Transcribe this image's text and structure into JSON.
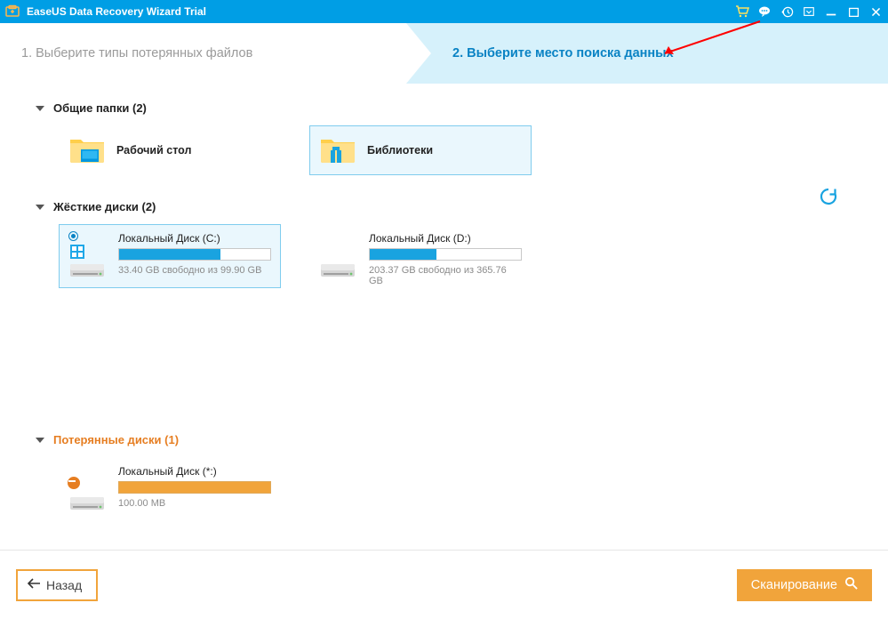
{
  "titlebar": {
    "app_name": "EaseUS Data Recovery Wizard Trial"
  },
  "steps": {
    "step1": "1. Выберите типы потерянных файлов",
    "step2": "2. Выберите место поиска данных"
  },
  "sections": {
    "common": {
      "title": "Общие папки (2)"
    },
    "hard": {
      "title": "Жёсткие диски (2)"
    },
    "lost": {
      "title": "Потерянные диски (1)"
    }
  },
  "common_folders": {
    "desktop": {
      "label": "Рабочий стол"
    },
    "libraries": {
      "label": "Библиотеки"
    }
  },
  "disks": {
    "c": {
      "name": "Локальный Диск (C:)",
      "free_text": "33.40 GB свободно из 99.90 GB",
      "fill_pct": 67
    },
    "d": {
      "name": "Локальный Диск (D:)",
      "free_text": "203.37 GB свободно из 365.76 GB",
      "fill_pct": 44
    }
  },
  "lost_disks": {
    "star": {
      "name": "Локальный Диск (*:)",
      "free_text": "100.00 MB",
      "fill_pct": 100
    }
  },
  "footer": {
    "back": "Назад",
    "scan": "Сканирование"
  },
  "colors": {
    "primary": "#009ee5",
    "accent": "#f1a43b",
    "step_active_bg": "#d6f1fb"
  }
}
